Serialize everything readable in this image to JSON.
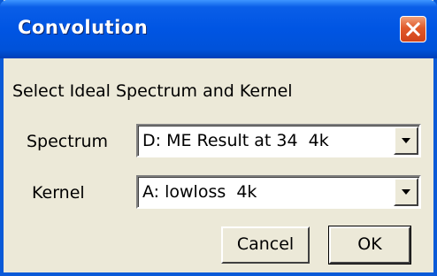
{
  "window": {
    "title": "Convolution"
  },
  "dialog": {
    "prompt": "Select Ideal Spectrum and Kernel",
    "spectrum": {
      "label": "Spectrum",
      "value": "D: ME Result at 34  4k"
    },
    "kernel": {
      "label": "Kernel",
      "value": "A: lowloss  4k"
    },
    "cancel_label": "Cancel",
    "ok_label": "OK"
  },
  "icons": {
    "close": "close-icon",
    "dropdown": "chevron-down-icon"
  },
  "colors": {
    "titlebar": "#0055e3",
    "window_bg": "#ece9d8",
    "close_button": "#e15a2a"
  }
}
